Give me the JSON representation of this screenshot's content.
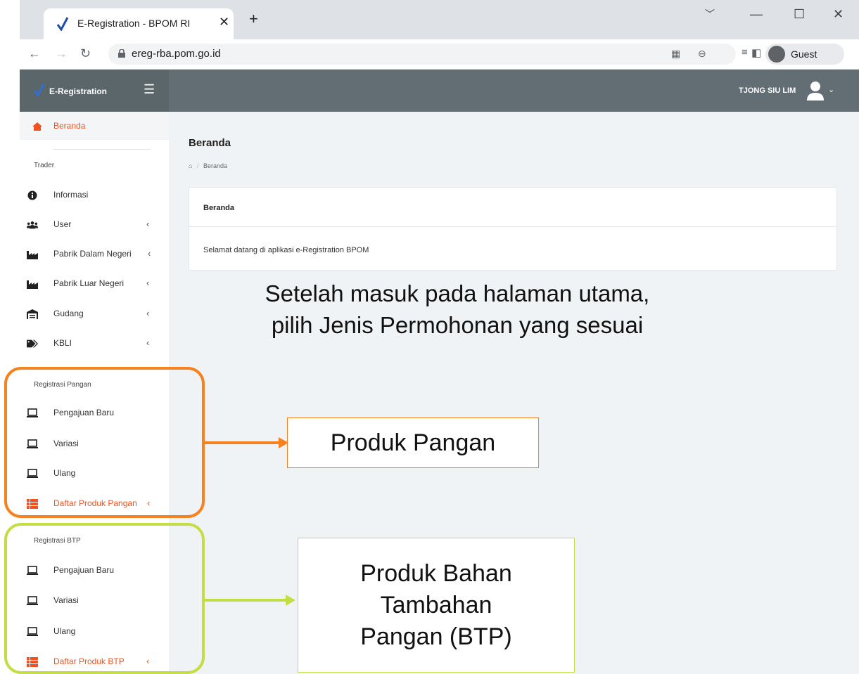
{
  "browser": {
    "tab_title": "E-Registration - BPOM RI",
    "tab_close": "✕",
    "new_tab": "+",
    "url": "ereg-rba.pom.go.id",
    "profile_label": "Guest",
    "window_controls": [
      "﹀",
      "—",
      "☐",
      "✕"
    ]
  },
  "header": {
    "brand": "E-Registration",
    "user_name": "TJONG SIU LIM"
  },
  "sidebar": {
    "active_item": "Beranda",
    "trader_heading": "Trader",
    "trader_items": [
      {
        "label": "Informasi",
        "icon": "info-icon",
        "chevron": ""
      },
      {
        "label": "User",
        "icon": "users-icon",
        "chevron": "‹"
      },
      {
        "label": "Pabrik Dalam Negeri",
        "icon": "factory-icon",
        "chevron": "‹"
      },
      {
        "label": "Pabrik Luar Negeri",
        "icon": "factory-icon",
        "chevron": "‹"
      },
      {
        "label": "Gudang",
        "icon": "warehouse-icon",
        "chevron": "‹"
      },
      {
        "label": "KBLI",
        "icon": "tag-icon",
        "chevron": "‹"
      }
    ],
    "pangan_heading": "Registrasi Pangan",
    "pangan_items": [
      {
        "label": "Pengajuan Baru",
        "icon": "laptop-icon"
      },
      {
        "label": "Variasi",
        "icon": "laptop-icon"
      },
      {
        "label": "Ulang",
        "icon": "laptop-icon"
      }
    ],
    "pangan_list": "Daftar Produk Pangan",
    "btp_heading": "Registrasi BTP",
    "btp_items": [
      {
        "label": "Pengajuan Baru",
        "icon": "laptop-icon"
      },
      {
        "label": "Variasi",
        "icon": "laptop-icon"
      },
      {
        "label": "Ulang",
        "icon": "laptop-icon"
      }
    ],
    "btp_list": "Daftar Produk BTP",
    "chevron": "‹"
  },
  "main": {
    "page_title": "Beranda",
    "breadcrumb": "Beranda",
    "breadcrumb_sep": "/",
    "card_title": "Beranda",
    "card_body": "Selamat datang di aplikasi e-Registration BPOM"
  },
  "annotations": {
    "instruction_line1": "Setelah masuk pada halaman utama,",
    "instruction_line2": "pilih Jenis Permohonan yang sesuai",
    "pangan_callout": "Produk Pangan",
    "btp_callout_line1": "Produk Bahan",
    "btp_callout_line2": "Tambahan",
    "btp_callout_line3": "Pangan (BTP)",
    "orange_color": "#f5821f",
    "green_color": "#c5dd45"
  },
  "colors": {
    "header_bg": "#636e74",
    "accent": "#f4511e",
    "main_bg": "#f0f3f5"
  }
}
